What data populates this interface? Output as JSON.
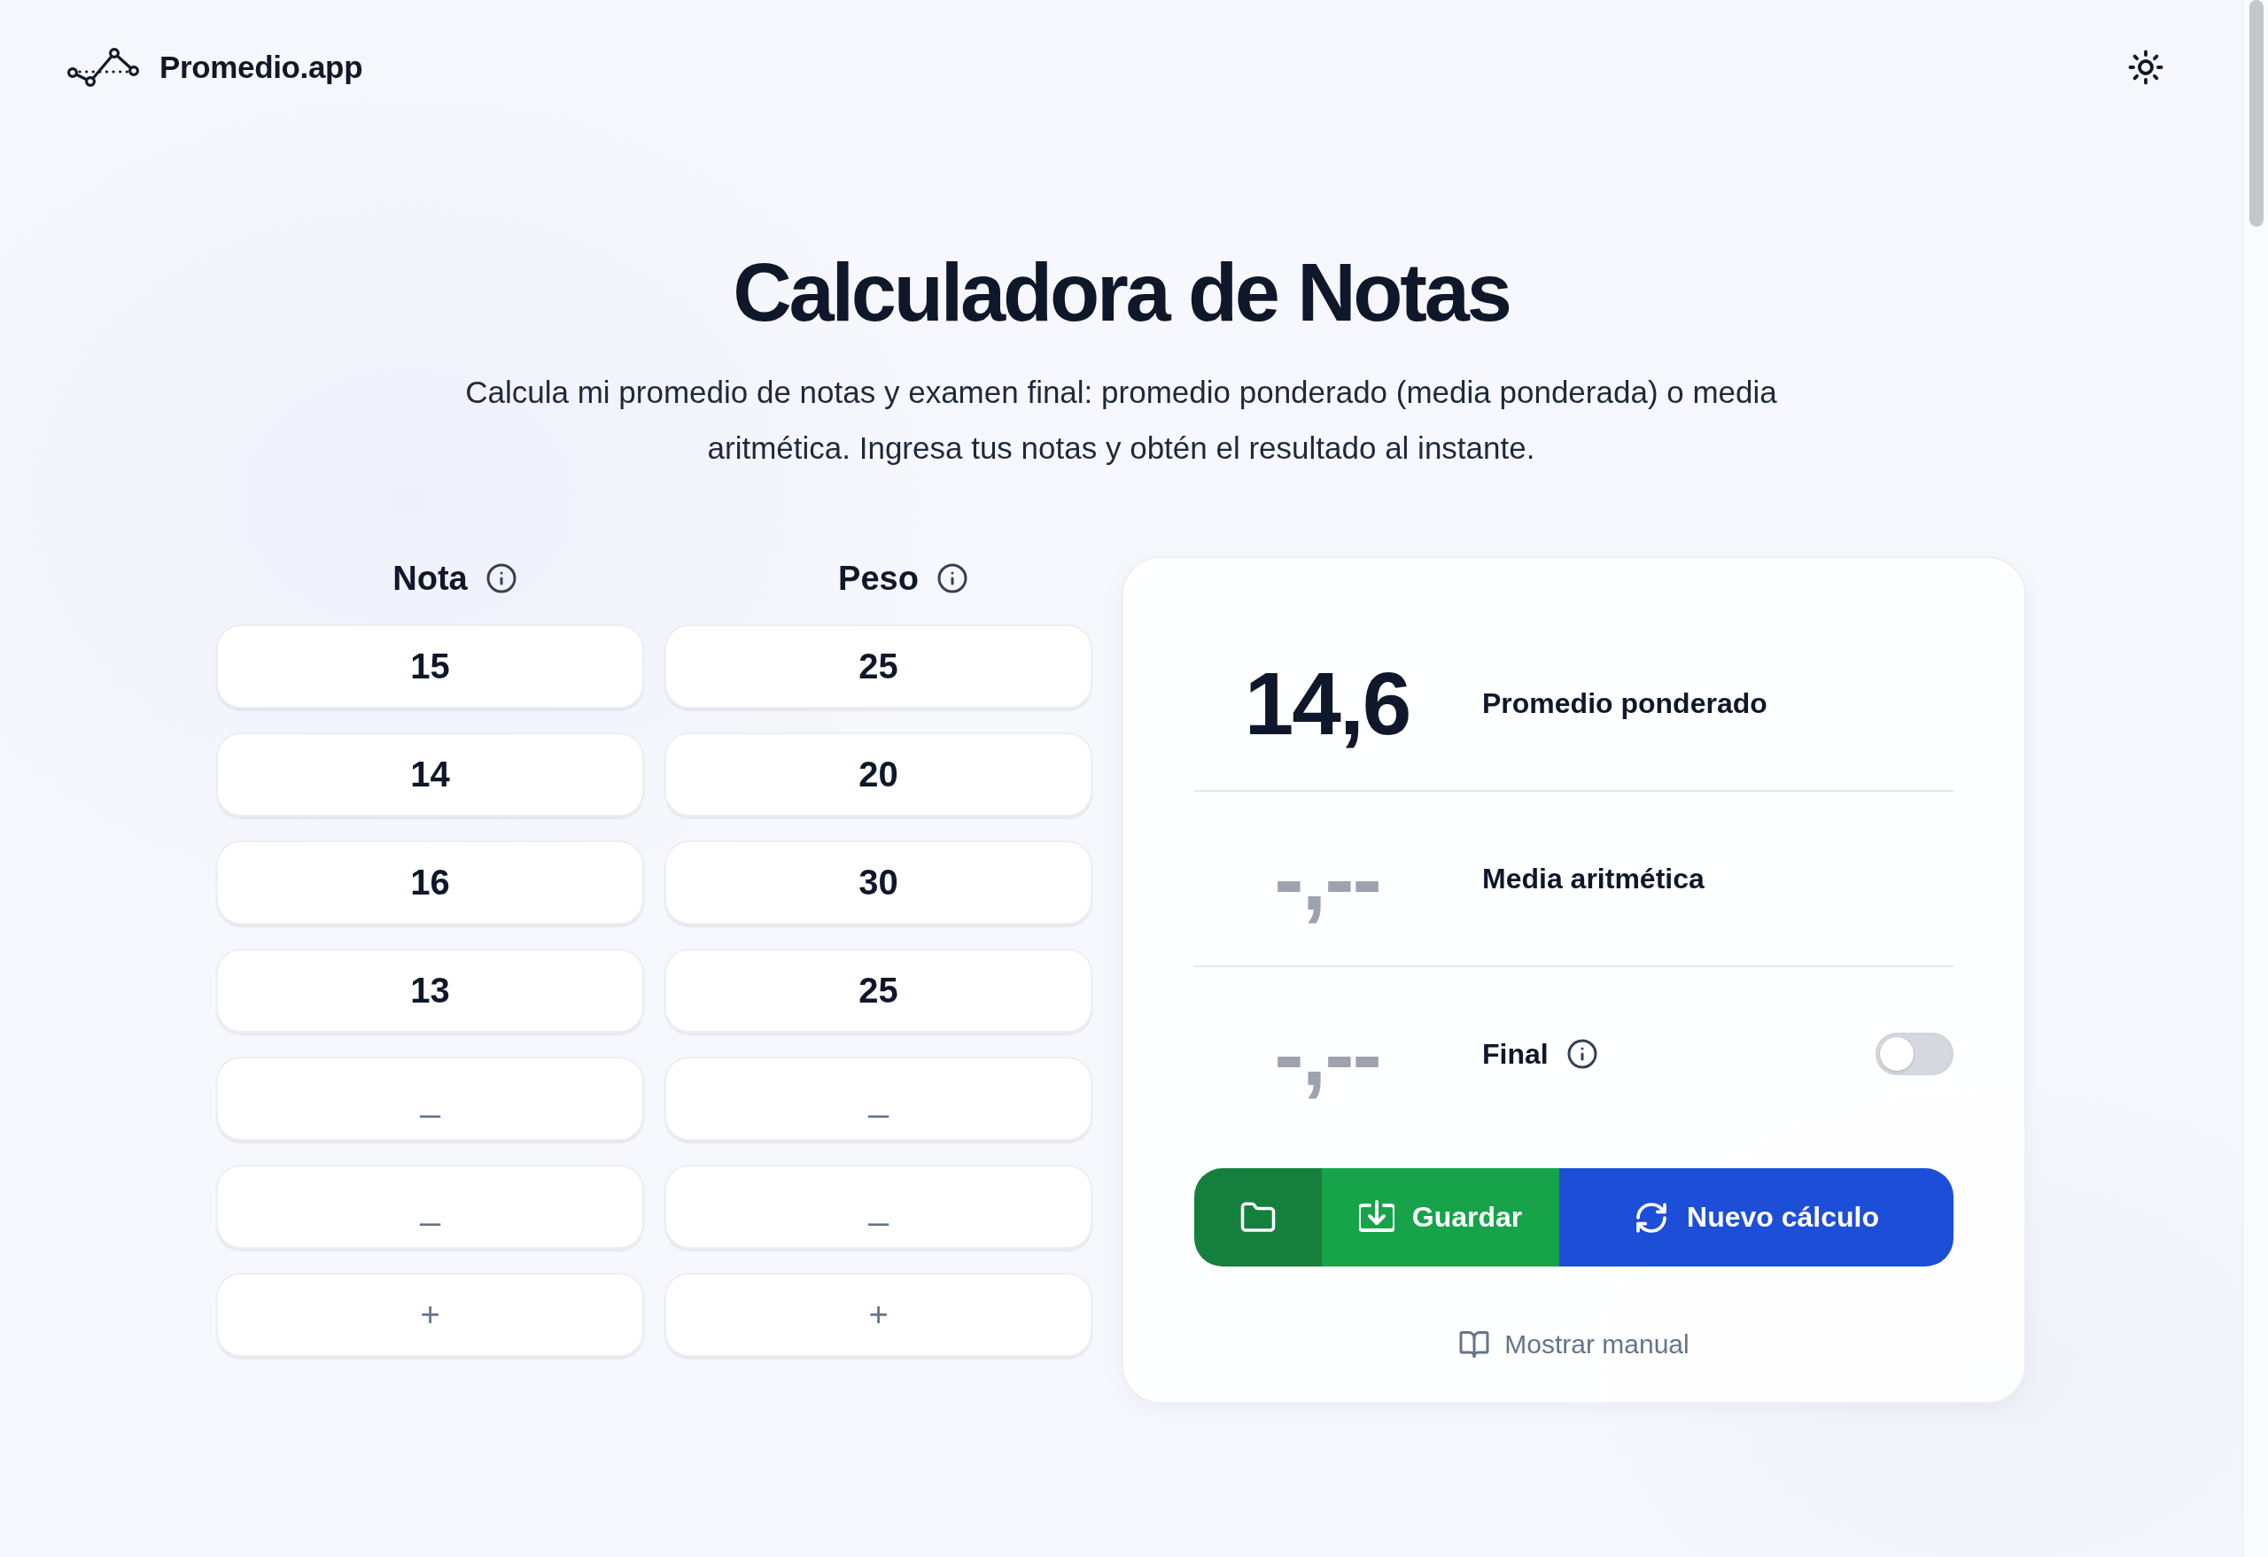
{
  "brand": {
    "name": "Promedio.app"
  },
  "hero": {
    "title": "Calculadora de Notas",
    "subtitle": "Calcula mi promedio de notas y examen final: promedio ponderado (media ponderada) o media aritmética. Ingresa tus notas y obtén el resultado al instante."
  },
  "grade_columns": [
    {
      "label": "Nota",
      "cells": [
        {
          "kind": "value",
          "value": "15"
        },
        {
          "kind": "value",
          "value": "14"
        },
        {
          "kind": "value",
          "value": "16"
        },
        {
          "kind": "value",
          "value": "13"
        },
        {
          "kind": "empty",
          "placeholder": "_"
        },
        {
          "kind": "empty",
          "placeholder": "_"
        },
        {
          "kind": "add",
          "label": "+"
        }
      ]
    },
    {
      "label": "Peso",
      "cells": [
        {
          "kind": "value",
          "value": "25"
        },
        {
          "kind": "value",
          "value": "20"
        },
        {
          "kind": "value",
          "value": "30"
        },
        {
          "kind": "value",
          "value": "25"
        },
        {
          "kind": "empty",
          "placeholder": "_"
        },
        {
          "kind": "empty",
          "placeholder": "_"
        },
        {
          "kind": "add",
          "label": "+"
        }
      ]
    }
  ],
  "results": [
    {
      "kind": "plain",
      "value": "14,6",
      "computed": true,
      "label": "Promedio ponderado"
    },
    {
      "kind": "plain",
      "value": "-,--",
      "computed": false,
      "label": "Media aritmética"
    },
    {
      "kind": "toggle",
      "value": "-,--",
      "computed": false,
      "label": "Final",
      "on": false
    }
  ],
  "actions": [
    {
      "kind": "open"
    },
    {
      "kind": "save",
      "label": "Guardar"
    },
    {
      "kind": "new",
      "label": "Nuevo cálculo"
    }
  ],
  "manual_link": {
    "label": "Mostrar manual"
  }
}
